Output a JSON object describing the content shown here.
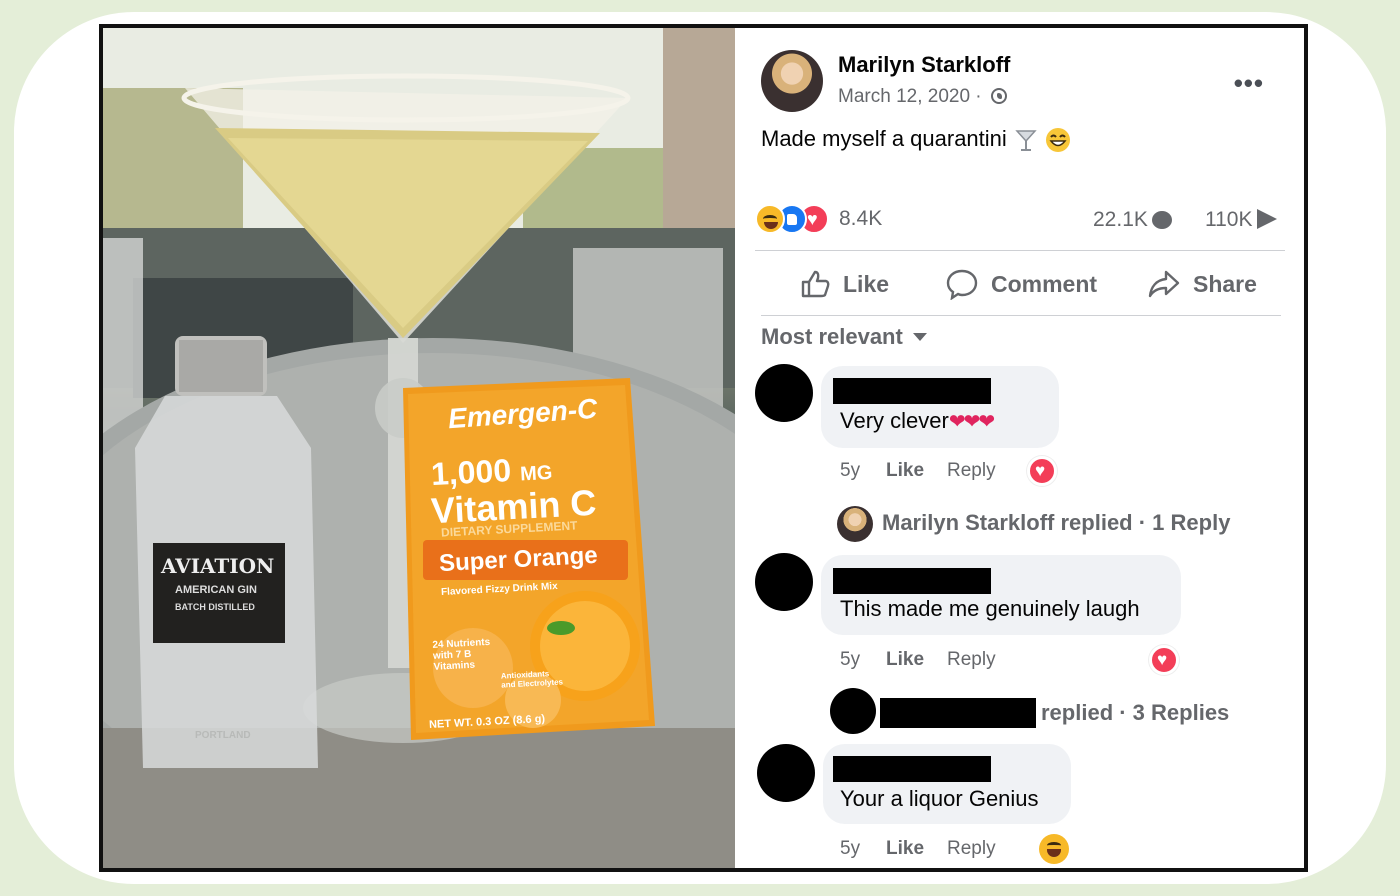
{
  "post": {
    "author": "Marilyn Starkloff",
    "date": "March 12, 2020 · ",
    "text": "Made myself a quarantini",
    "reaction_count": "8.4K",
    "comment_count": "22.1K",
    "share_count": "110K",
    "actions": {
      "like": "Like",
      "comment": "Comment",
      "share": "Share"
    },
    "sort_label": "Most relevant"
  },
  "photo": {
    "gin_label": {
      "brand": "AVIATION",
      "line1": "AMERICAN GIN",
      "line2": "BATCH DISTILLED",
      "city": "PORTLAND"
    },
    "packet": {
      "brand": "Emergen-C",
      "dose": "1,000",
      "dose_unit": "MG",
      "product": "Vitamin C",
      "sub": "DIETARY SUPPLEMENT",
      "flavor": "Super Orange",
      "flavor_sub": "Flavored Fizzy Drink Mix",
      "nutrients": "24 Nutrients with 7 B Vitamins",
      "antioxidants": "Antioxidants and Electrolytes",
      "net_wt": "NET WT. 0.3 OZ (8.6 g)"
    }
  },
  "comments": [
    {
      "text": "Very clever",
      "age": "5y",
      "like": "Like",
      "reply": "Reply",
      "reaction": "love"
    },
    {
      "text": "This made me genuinely laugh",
      "age": "5y",
      "like": "Like",
      "reply": "Reply",
      "reaction": "love"
    },
    {
      "text": "Your a liquor Genius",
      "age": "5y",
      "like": "Like",
      "reply": "Reply",
      "reaction": "haha"
    }
  ],
  "reply_threads": [
    {
      "text": "Marilyn Starkloff replied · 1 Reply"
    },
    {
      "text": "replied · 3 Replies"
    }
  ],
  "colors": {
    "frame": "#e4eed8",
    "facebook_blue": "#1877f2",
    "love_red": "#f33e58",
    "muted": "#65676b",
    "bubble": "#f0f2f5"
  }
}
